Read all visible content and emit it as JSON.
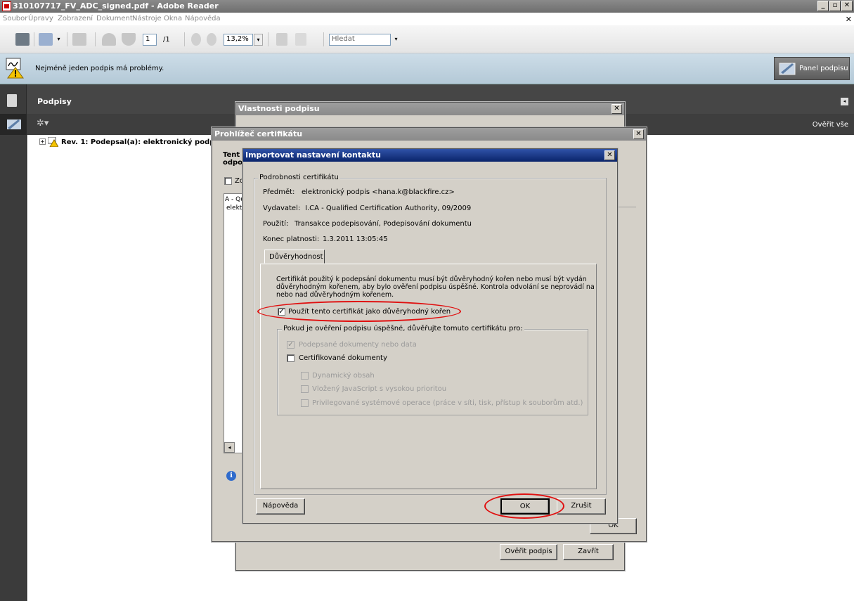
{
  "window": {
    "title": "310107717_FV_ADC_signed.pdf - Adobe Reader"
  },
  "menu": [
    "Soubor",
    "Úpravy",
    "Zobrazení",
    "Dokument",
    "Nástroje",
    "Okna",
    "Nápověda"
  ],
  "toolbar": {
    "page_current": "1",
    "page_total": "/1",
    "zoom": "13,2%",
    "search_placeholder": "Hledat"
  },
  "message_bar": {
    "text": "Nejméně jeden podpis má problémy.",
    "panel_button": "Panel podpisu"
  },
  "signatures_panel": {
    "title": "Podpisy",
    "verify_all": "Ověřit vše",
    "item": "Rev. 1: Podepsal(a): elektronický podpis"
  },
  "dlg_props": {
    "title": "Vlastnosti podpisu",
    "verify_button": "Ověřit podpis",
    "close_button": "Zavřít",
    "ok_button": "OK"
  },
  "dlg_cert": {
    "title": "Prohlížeč certifikátu",
    "text1": "Tent",
    "text2": "odpo",
    "cb_text": "Zo",
    "list_line1": "A - Qu",
    "list_line2": "elekt"
  },
  "dlg_import": {
    "title": "Importovat nastavení kontaktu",
    "group_label": "Podrobnosti certifikátu",
    "subject_label": "Předmět:",
    "subject": "elektronický podpis <hana.k@blackfire.cz>",
    "issuer_label": "Vydavatel:",
    "issuer": "I.CA - Qualified Certification Authority, 09/2009",
    "usage_label": "Použití:",
    "usage": "Transakce podepisování, Podepisování dokumentu",
    "expiry_label": "Konec platnosti:",
    "expiry": "1.3.2011 13:05:45",
    "tab": "Důvěryhodnost",
    "trust_line1": "Certifikát použitý k podepsání dokumentu musí být důvěryhodný kořen nebo musí být vydán",
    "trust_line2": "důvěryhodným kořenem, aby bylo ověření podpisu úspěšné.  Kontrola odvolání se neprovádí na",
    "trust_line3": "nebo nad důvěryhodným kořenem.",
    "use_as_root": "Použít tento certifikát jako důvěryhodný kořen",
    "use_as_root_checked": true,
    "trust_group": "Pokud je ověření podpisu úspěšné, důvěřujte tomuto certifikátu pro:",
    "opt_signed": "Podepsané dokumenty nebo data",
    "opt_certified": "Certifikované dokumenty",
    "opt_dynamic": "Dynamický obsah",
    "opt_js": "Vložený JavaScript s vysokou prioritou",
    "opt_priv": "Privilegované systémové operace (práce v síti, tisk, přístup k souborům atd.)",
    "help_button": "Nápověda",
    "ok_button": "OK",
    "cancel_button": "Zrušit"
  },
  "colors": {
    "highlight_red": "#e01010",
    "active_title": "#0a246a"
  }
}
